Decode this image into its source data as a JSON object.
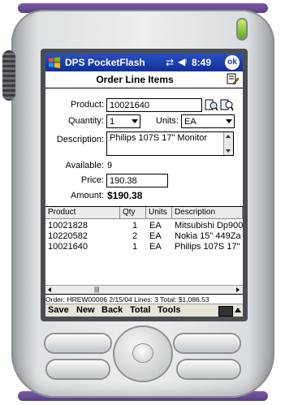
{
  "status_bar": {
    "app_title": "DPS PocketFlash",
    "time": "8:49",
    "ok_label": "ok",
    "icons": [
      "windows-start-icon",
      "sync-icon",
      "speaker-icon"
    ]
  },
  "page": {
    "title": "Order Line Items",
    "header_icon": "edit-note-icon"
  },
  "form": {
    "product_label": "Product:",
    "product_value": "10021640",
    "quantity_label": "Quantity:",
    "quantity_value": "1",
    "units_label": "Units:",
    "units_value": "EA",
    "description_label": "Description:",
    "description_value": "Philips 107S 17\" Monitor",
    "available_label": "Available:",
    "available_value": "9",
    "price_label": "Price:",
    "price_value": "190.38",
    "amount_label": "Amount:",
    "amount_value": "$190.38"
  },
  "grid": {
    "columns": [
      "Product",
      "Qty",
      "Units",
      "Description"
    ],
    "rows": [
      {
        "product": "10021828",
        "qty": "1",
        "units": "EA",
        "description": "Mitsubishi Dp900"
      },
      {
        "product": "10220582",
        "qty": "2",
        "units": "EA",
        "description": "Nokia 15\" 449Za"
      },
      {
        "product": "10021640",
        "qty": "1",
        "units": "EA",
        "description": "Philips 107S 17\""
      }
    ]
  },
  "footer_status": "Order: HREW00006 2/15/04 Lines: 3 Total: $1,086.53",
  "menu": [
    "Save",
    "New",
    "Back",
    "Total",
    "Tools"
  ],
  "colors": {
    "titlebar": "#1a3aa8",
    "device_band": "#6b4c96",
    "led": "#7cc832"
  }
}
